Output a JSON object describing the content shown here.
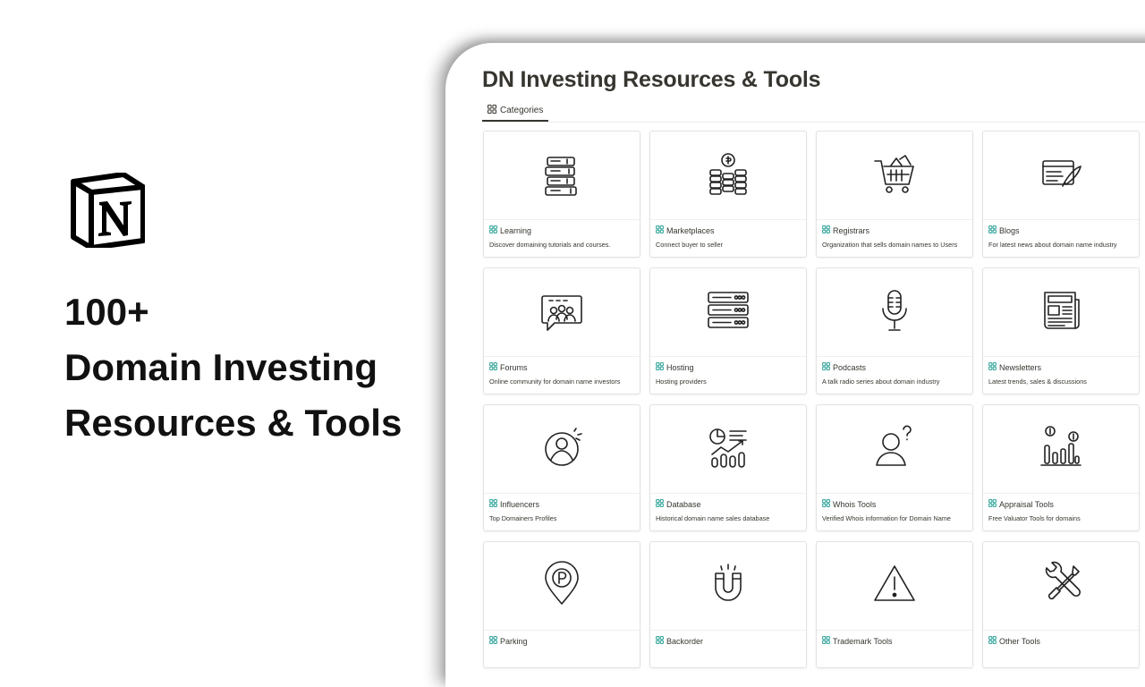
{
  "promo": {
    "logo_icon": "notion-logo-icon",
    "line1": "100+",
    "line2": "Domain Investing",
    "line3": "Resources & Tools"
  },
  "notion": {
    "title": "DN Investing Resources & Tools",
    "view_tab": {
      "label": "Categories",
      "icon": "gallery-view-icon"
    },
    "accent_color": "#3aa99f",
    "cards": [
      {
        "icon": "books-icon",
        "title": "Learning",
        "description": "Discover domaining tutorials and courses."
      },
      {
        "icon": "coin-stacks-icon",
        "title": "Marketplaces",
        "description": "Connect buyer to seller"
      },
      {
        "icon": "shopping-cart-icon",
        "title": "Registrars",
        "description": "Organization that sells domain names to Users"
      },
      {
        "icon": "blog-pen-icon",
        "title": "Blogs",
        "description": "For latest news about domain name industry"
      },
      {
        "icon": "community-chat-icon",
        "title": "Forums",
        "description": "Online community for domain name investors"
      },
      {
        "icon": "server-stack-icon",
        "title": "Hosting",
        "description": "Hosting providers"
      },
      {
        "icon": "microphone-icon",
        "title": "Podcasts",
        "description": "A talk radio series about domain industry"
      },
      {
        "icon": "newspaper-icon",
        "title": "Newsletters",
        "description": "Latest trends, sales & discussions"
      },
      {
        "icon": "influencer-profile-icon",
        "title": "Influencers",
        "description": "Top Domainers Profiles"
      },
      {
        "icon": "database-chart-icon",
        "title": "Database",
        "description": "Historical domain name sales database"
      },
      {
        "icon": "user-question-icon",
        "title": "Whois Tools",
        "description": "Verified Whois information for Domain Name"
      },
      {
        "icon": "valuation-chart-icon",
        "title": "Appraisal Tools",
        "description": "Free Valuator Tools for domains"
      },
      {
        "icon": "parking-pin-icon",
        "title": "Parking",
        "description": ""
      },
      {
        "icon": "magnet-icon",
        "title": "Backorder",
        "description": ""
      },
      {
        "icon": "warning-triangle-icon",
        "title": "Trademark Tools",
        "description": ""
      },
      {
        "icon": "tools-wrench-icon",
        "title": "Other Tools",
        "description": ""
      }
    ]
  }
}
